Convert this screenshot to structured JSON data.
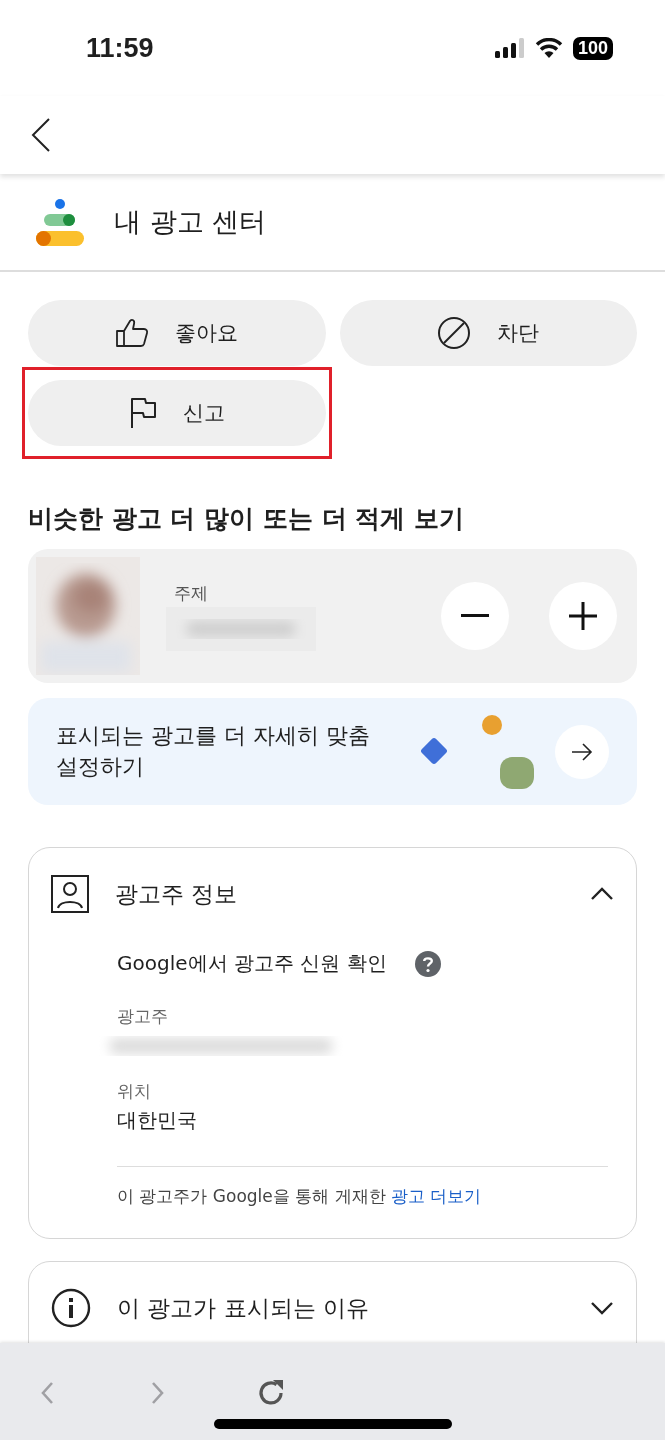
{
  "status_bar": {
    "time": "11:59",
    "battery": "100"
  },
  "header": {
    "title": "내 광고 센터"
  },
  "actions": [
    {
      "label": "좋아요",
      "kind": "like",
      "highlighted": false
    },
    {
      "label": "차단",
      "kind": "block",
      "highlighted": false
    },
    {
      "label": "신고",
      "kind": "report",
      "highlighted": true
    }
  ],
  "section_title": "비슷한 광고 더 많이 또는 더 적게 보기",
  "topic": {
    "label": "주제"
  },
  "customize": {
    "text": "표시되는 광고를 더 자세히 맞춤 설정하기"
  },
  "advertiser_card": {
    "title": "광고주 정보",
    "expanded": true,
    "verified_text": "Google에서 광고주 신원 확인",
    "advertiser_label": "광고주",
    "location_label": "위치",
    "location": "대한민국",
    "more_text": "이 광고주가 Google을 통해 게재한 ",
    "more_link": "광고 더보기"
  },
  "reason_card": {
    "title": "이 광고가 표시되는 이유",
    "expanded": false
  }
}
